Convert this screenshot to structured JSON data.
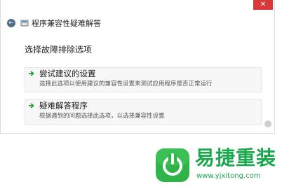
{
  "window": {
    "title": "程序兼容性疑难解答",
    "close_label": "✕"
  },
  "heading": "选择故障排除选项",
  "options": [
    {
      "title": "尝试建议的设置",
      "description": "选择此选项以使用建议的兼容性设置来测试应用程序是否正常运行"
    },
    {
      "title": "疑难解答程序",
      "description": "根据遇到的问题选择此选项，以选择兼容性设置"
    }
  ],
  "watermark": {
    "brand": "易捷重装",
    "url": "www.yjxitong.com"
  },
  "colors": {
    "accent_green": "#19a84d",
    "close_red": "#d8383a",
    "back_button": "#4d6e86"
  },
  "icons": [
    "back-arrow-icon",
    "app-icon",
    "arrow-right-icon",
    "power-logo-icon"
  ]
}
